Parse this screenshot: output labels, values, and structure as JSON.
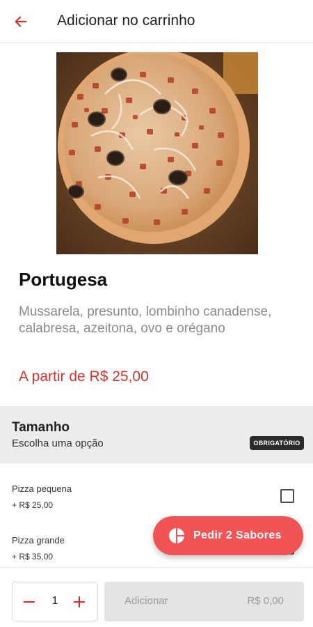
{
  "header": {
    "title": "Adicionar no carrinho",
    "back_icon": "arrow-left-icon",
    "accent_color": "#d0342c"
  },
  "product": {
    "name": "Portugesa",
    "description": "Mussarela, presunto, lombinho canadense, calabresa, azeitona, ovo e orégano",
    "price": "A partir de R$ 25,00"
  },
  "section": {
    "title": "Tamanho",
    "subtitle": "Escolha uma opção",
    "badge": "OBRIGATÓRIO"
  },
  "options": [
    {
      "name": "Pizza pequena",
      "price": "+ R$ 25,00",
      "checked": false
    },
    {
      "name": "Pizza grande",
      "price": "+ R$ 35,00",
      "checked": false
    }
  ],
  "fab": {
    "label": "Pedir 2 Sabores",
    "icon": "half-pizza-icon",
    "color": "#f25456"
  },
  "cart": {
    "quantity": "1",
    "add_label": "Adicionar",
    "total": "R$ 0,00"
  }
}
